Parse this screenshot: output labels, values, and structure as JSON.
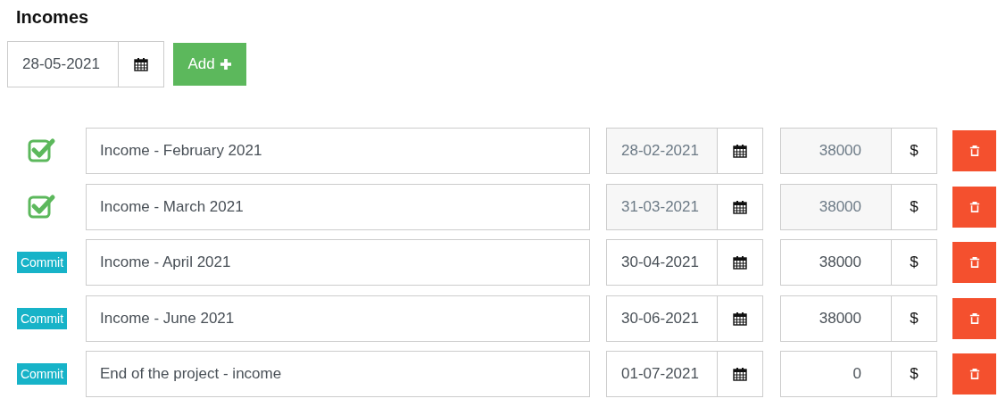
{
  "title": "Incomes",
  "new_entry": {
    "date": "28-05-2021",
    "add_label": "Add"
  },
  "rows": [
    {
      "committed": true,
      "name": "Income - February 2021",
      "date": "28-02-2021",
      "amount": "38000",
      "currency": "$"
    },
    {
      "committed": true,
      "name": "Income - March 2021",
      "date": "31-03-2021",
      "amount": "38000",
      "currency": "$"
    },
    {
      "committed": false,
      "commit_label": "Commit",
      "name": "Income - April 2021",
      "date": "30-04-2021",
      "amount": "38000",
      "currency": "$"
    },
    {
      "committed": false,
      "commit_label": "Commit",
      "name": "Income - June 2021",
      "date": "30-06-2021",
      "amount": "38000",
      "currency": "$"
    },
    {
      "committed": false,
      "commit_label": "Commit",
      "name": "End of the project - income",
      "date": "01-07-2021",
      "amount": "0",
      "currency": "$"
    }
  ]
}
